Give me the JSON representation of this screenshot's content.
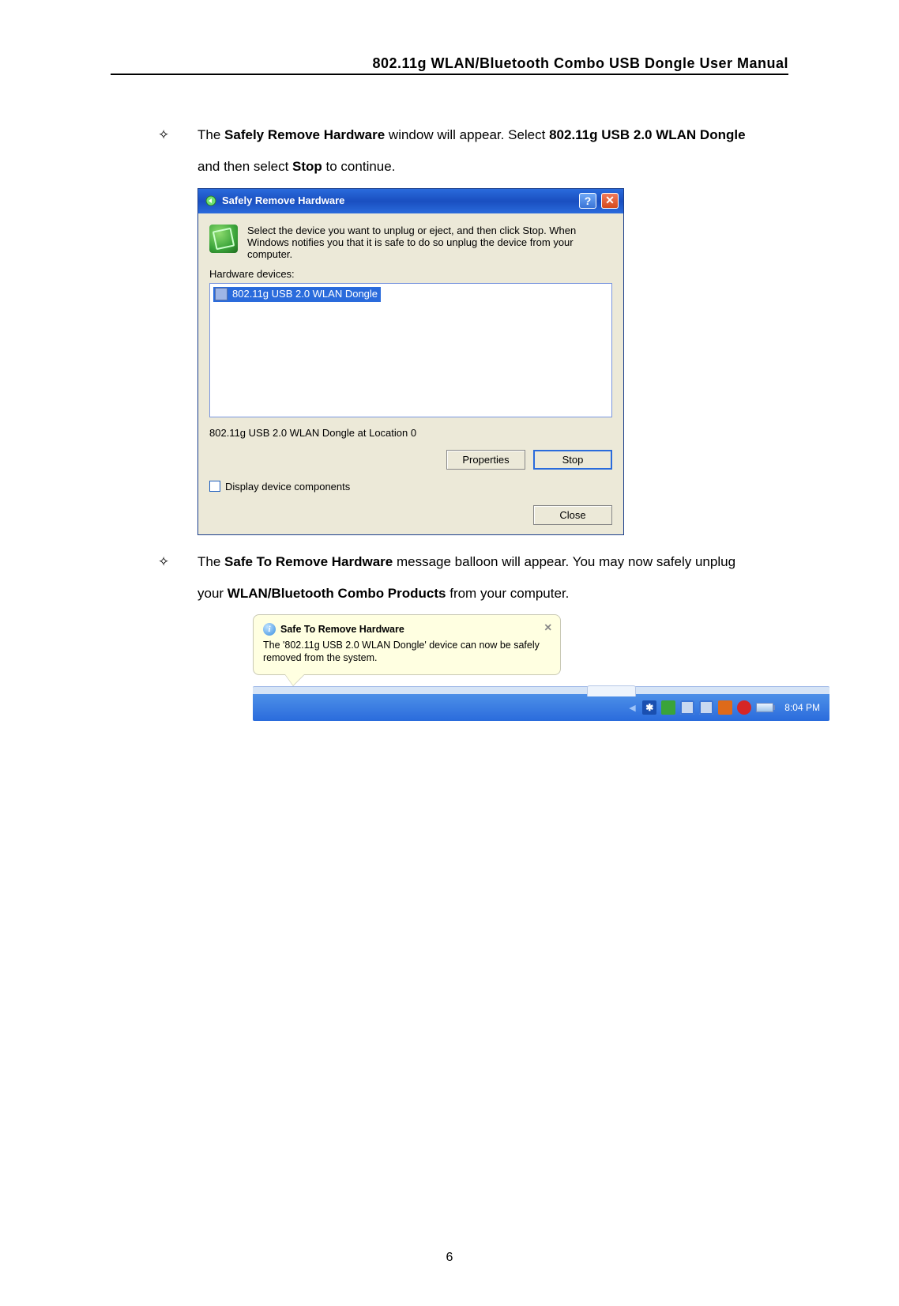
{
  "header": {
    "title": "802.11g  WLAN/Bluetooth  Combo  USB  Dongle  User  Manual"
  },
  "bullets": {
    "sym": "✧",
    "b1_pre": "The ",
    "b1_bold1": "Safely Remove Hardware",
    "b1_mid": " window will appear. Select ",
    "b1_bold2": "802.11g USB 2.0 WLAN Dongle",
    "b1_post1": "and then select ",
    "b1_bold3": "Stop",
    "b1_post2": " to continue.",
    "b2_pre": "The ",
    "b2_bold1": "Safe To Remove Hardware",
    "b2_mid": " message balloon will appear. You may now safely unplug",
    "b2_post1": "your ",
    "b2_bold2": "WLAN/Bluetooth Combo Products",
    "b2_post2": " from your computer."
  },
  "dialog": {
    "title": "Safely Remove Hardware",
    "help": "?",
    "close": "✕",
    "intro": "Select the device you want to unplug or eject, and then click Stop. When Windows notifies you that it is safe to do so unplug the device from your computer.",
    "hw_label": "Hardware devices:",
    "device": "802.11g USB 2.0 WLAN Dongle",
    "location": "802.11g USB 2.0 WLAN Dongle at Location 0",
    "btn_properties": "Properties",
    "btn_stop": "Stop",
    "chk_label": "Display device components",
    "btn_close": "Close"
  },
  "balloon": {
    "title": "Safe To Remove Hardware",
    "close": "✕",
    "msg": "The '802.11g USB 2.0 WLAN Dongle' device can now be safely removed from the system."
  },
  "tray": {
    "bt": "✱",
    "clock": "8:04 PM"
  },
  "page_number": "6"
}
